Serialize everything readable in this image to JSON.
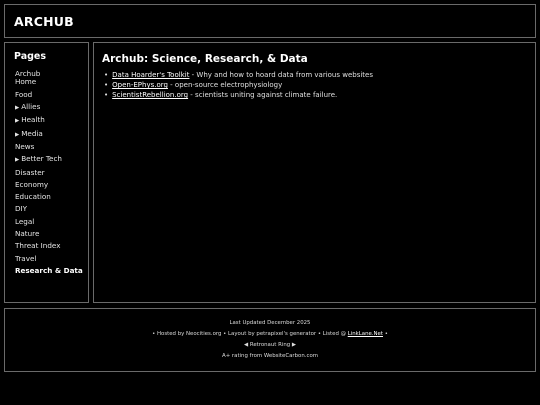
{
  "header": {
    "title": "ARCHUB"
  },
  "sidebar": {
    "heading": "Pages",
    "items": [
      {
        "label": "Archub Home",
        "prefix": ""
      },
      {
        "label": "Food",
        "prefix": ""
      },
      {
        "label": "Allies",
        "prefix": "▶"
      },
      {
        "label": "Health",
        "prefix": "▶"
      },
      {
        "label": "Media",
        "prefix": "▶"
      },
      {
        "label": "News",
        "prefix": ""
      },
      {
        "label": "Better Tech",
        "prefix": "▶"
      },
      {
        "label": "Disaster",
        "prefix": ""
      },
      {
        "label": "Economy",
        "prefix": ""
      },
      {
        "label": "Education",
        "prefix": ""
      },
      {
        "label": "DIY",
        "prefix": ""
      },
      {
        "label": "Legal",
        "prefix": ""
      },
      {
        "label": "Nature",
        "prefix": ""
      },
      {
        "label": "Threat Index",
        "prefix": ""
      },
      {
        "label": "Travel",
        "prefix": ""
      },
      {
        "label": "Research & Data",
        "prefix": ""
      }
    ]
  },
  "main": {
    "title": "Archub: Science, Research, & Data",
    "links": [
      {
        "name": "Data Hoarder's Toolkit",
        "desc": " - Why and how to hoard data from various websites"
      },
      {
        "name": "Open-EPhys.org",
        "desc": " - open-source electrophysiology"
      },
      {
        "name": "ScientistRebellion.org",
        "desc": " - scientists uniting against climate failure."
      }
    ]
  },
  "footer": {
    "updated": "Last Updated December 2025",
    "credits_pre": "• Hosted by Neocities.org • Layout by petrapixel's generator • Listed @ ",
    "credits_link": "LinkLane.Net",
    "credits_post": " •",
    "webring_prev": "◀",
    "webring_name": "Retronaut Ring",
    "webring_next": "▶",
    "rating": "A+ rating from WebsiteCarbon.com"
  }
}
